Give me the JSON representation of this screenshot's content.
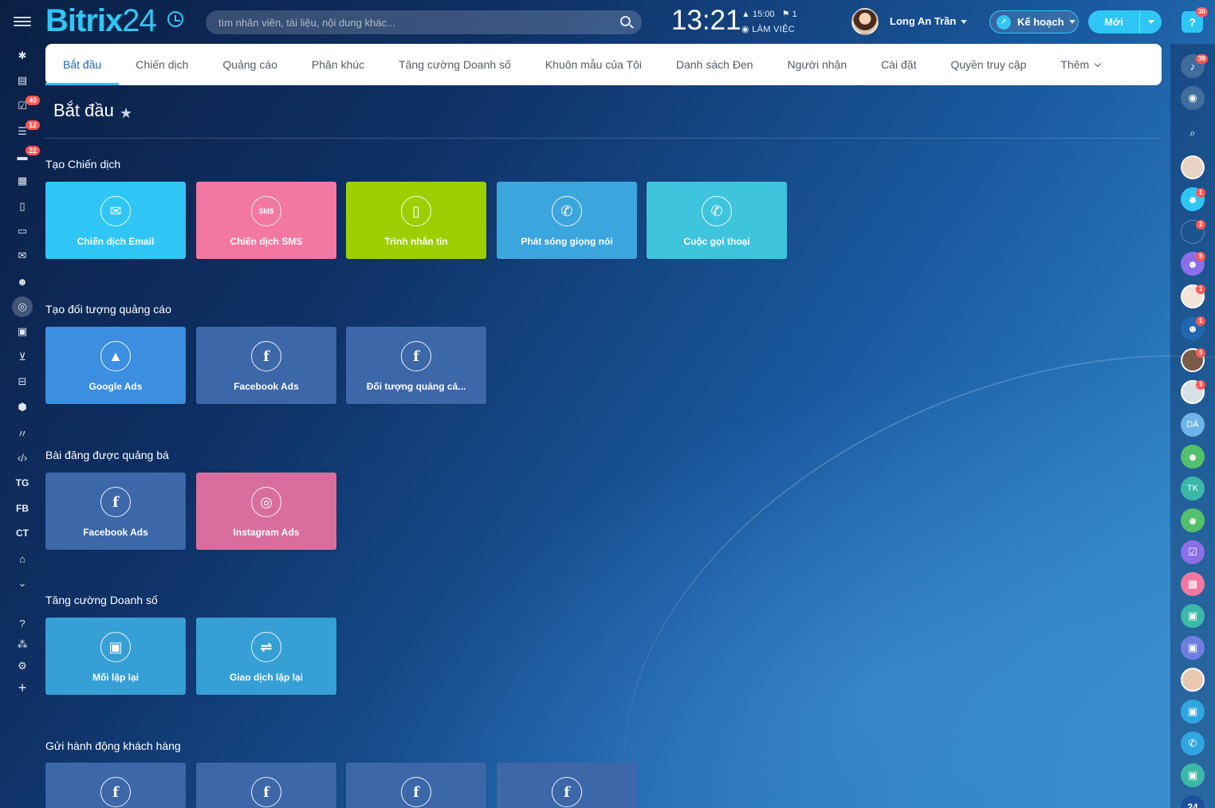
{
  "header": {
    "logo_bitrix": "Bitrix",
    "logo_24": "24",
    "search_placeholder": "tìm nhân viên, tài liệu, nội dung khác...",
    "time": "13:21",
    "alarm": "15:00",
    "flag_count": "1",
    "work_status": "LÀM VIỆC",
    "user_name": "Long An Trần",
    "plan_label": "Kế hoạch",
    "new_label": "Mới",
    "help_badge": "30"
  },
  "tabs": [
    {
      "label": "Bắt đầu",
      "active": true
    },
    {
      "label": "Chiến dịch"
    },
    {
      "label": "Quảng cáo"
    },
    {
      "label": "Phân khúc"
    },
    {
      "label": "Tăng cường Doanh số"
    },
    {
      "label": "Khuôn mẫu của Tôi"
    },
    {
      "label": "Danh sách Đen"
    },
    {
      "label": "Người nhận"
    },
    {
      "label": "Cài đặt"
    },
    {
      "label": "Quyền truy cập"
    },
    {
      "label": "Thêm"
    }
  ],
  "page": {
    "title": "Bắt đầu"
  },
  "sections": {
    "campaigns": {
      "title": "Tạo Chiến dịch",
      "tiles": [
        {
          "label": "Chiến dịch Email",
          "icon": "email-icon",
          "color": "#2fc6f6"
        },
        {
          "label": "Chiến dịch SMS",
          "icon": "sms-icon",
          "color": "#f278a1"
        },
        {
          "label": "Trình nhắn tin",
          "icon": "messenger-icon",
          "color": "#9dcf00"
        },
        {
          "label": "Phát sóng giọng nói",
          "icon": "voice-broadcast-icon",
          "color": "#3ba5dd"
        },
        {
          "label": "Cuộc gọi thoại",
          "icon": "phone-call-icon",
          "color": "#3ec4dc"
        }
      ]
    },
    "audience": {
      "title": "Tạo đối tượng quảng cáo",
      "tiles": [
        {
          "label": "Google Ads",
          "icon": "google-ads-icon",
          "color": "#3b8ee0"
        },
        {
          "label": "Facebook Ads",
          "icon": "facebook-icon",
          "color": "#3c67a8"
        },
        {
          "label": "Đối tượng quảng cá...",
          "icon": "facebook-icon",
          "color": "#3c67a8"
        }
      ]
    },
    "promoted": {
      "title": "Bài đăng được quảng bá",
      "tiles": [
        {
          "label": "Facebook Ads",
          "icon": "facebook-icon",
          "color": "#3c67a8"
        },
        {
          "label": "Instagram Ads",
          "icon": "instagram-icon",
          "color": "#d96e9e"
        }
      ]
    },
    "boost": {
      "title": "Tăng cường Doanh số",
      "tiles": [
        {
          "label": "Mối lặp lại",
          "icon": "repeat-lead-icon",
          "color": "#359fd6"
        },
        {
          "label": "Giao dịch lặp lại",
          "icon": "repeat-deal-icon",
          "color": "#359fd6"
        }
      ]
    },
    "customer_actions": {
      "title": "Gửi hành động khách hàng",
      "tiles": [
        {
          "label": "",
          "icon": "facebook-icon",
          "color": "#3c67a8"
        },
        {
          "label": "",
          "icon": "facebook-icon",
          "color": "#3c67a8"
        },
        {
          "label": "",
          "icon": "facebook-icon",
          "color": "#3c67a8"
        },
        {
          "label": "",
          "icon": "facebook-icon",
          "color": "#3c67a8"
        }
      ]
    }
  },
  "left_sidebar": {
    "badges": {
      "tasks": "40",
      "filter": "12",
      "chat": "22"
    },
    "text_items": [
      "TG",
      "FB",
      "CT"
    ]
  },
  "right_sidebar": {
    "badges": {
      "notifications": "39",
      "group1": "1",
      "group2": "2",
      "group3": "8",
      "user4": "1",
      "chat5": "1",
      "user6": "6",
      "user7": "3"
    },
    "initials": [
      "DÁ",
      "TK"
    ],
    "bottom_number": "24"
  }
}
